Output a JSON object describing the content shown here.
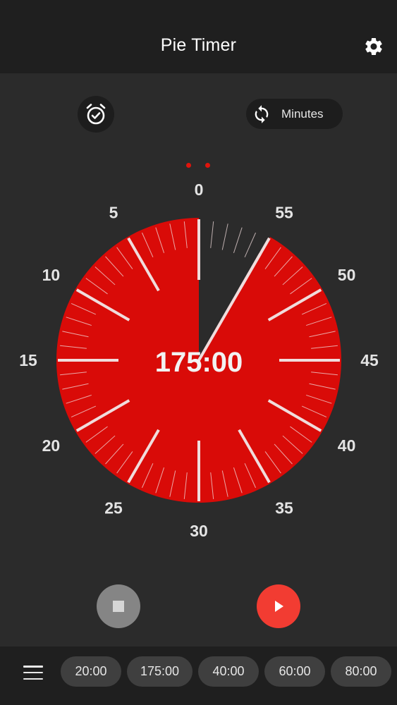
{
  "header": {
    "title": "Pie Timer",
    "settings_icon": "gear-icon"
  },
  "controls": {
    "alarm_icon": "alarm-clock-check-icon",
    "unit_icon": "refresh-arrows-icon",
    "unit_label": "Minutes"
  },
  "dial": {
    "time_display": "175:00",
    "labels": [
      "0",
      "5",
      "10",
      "15",
      "20",
      "25",
      "30",
      "35",
      "40",
      "45",
      "50",
      "55"
    ],
    "remaining_minutes_on_face": 55,
    "face_total_minutes": 60,
    "colors": {
      "pie": "#d90b08",
      "ticks": "#f0dcdc",
      "labels": "#e4e4e4",
      "background": "#2b2b2b"
    }
  },
  "playback": {
    "stop_icon": "stop-square-icon",
    "play_icon": "play-triangle-icon"
  },
  "bottom": {
    "menu_icon": "hamburger-menu-icon",
    "presets": [
      "20:00",
      "175:00",
      "40:00",
      "60:00",
      "80:00"
    ]
  }
}
